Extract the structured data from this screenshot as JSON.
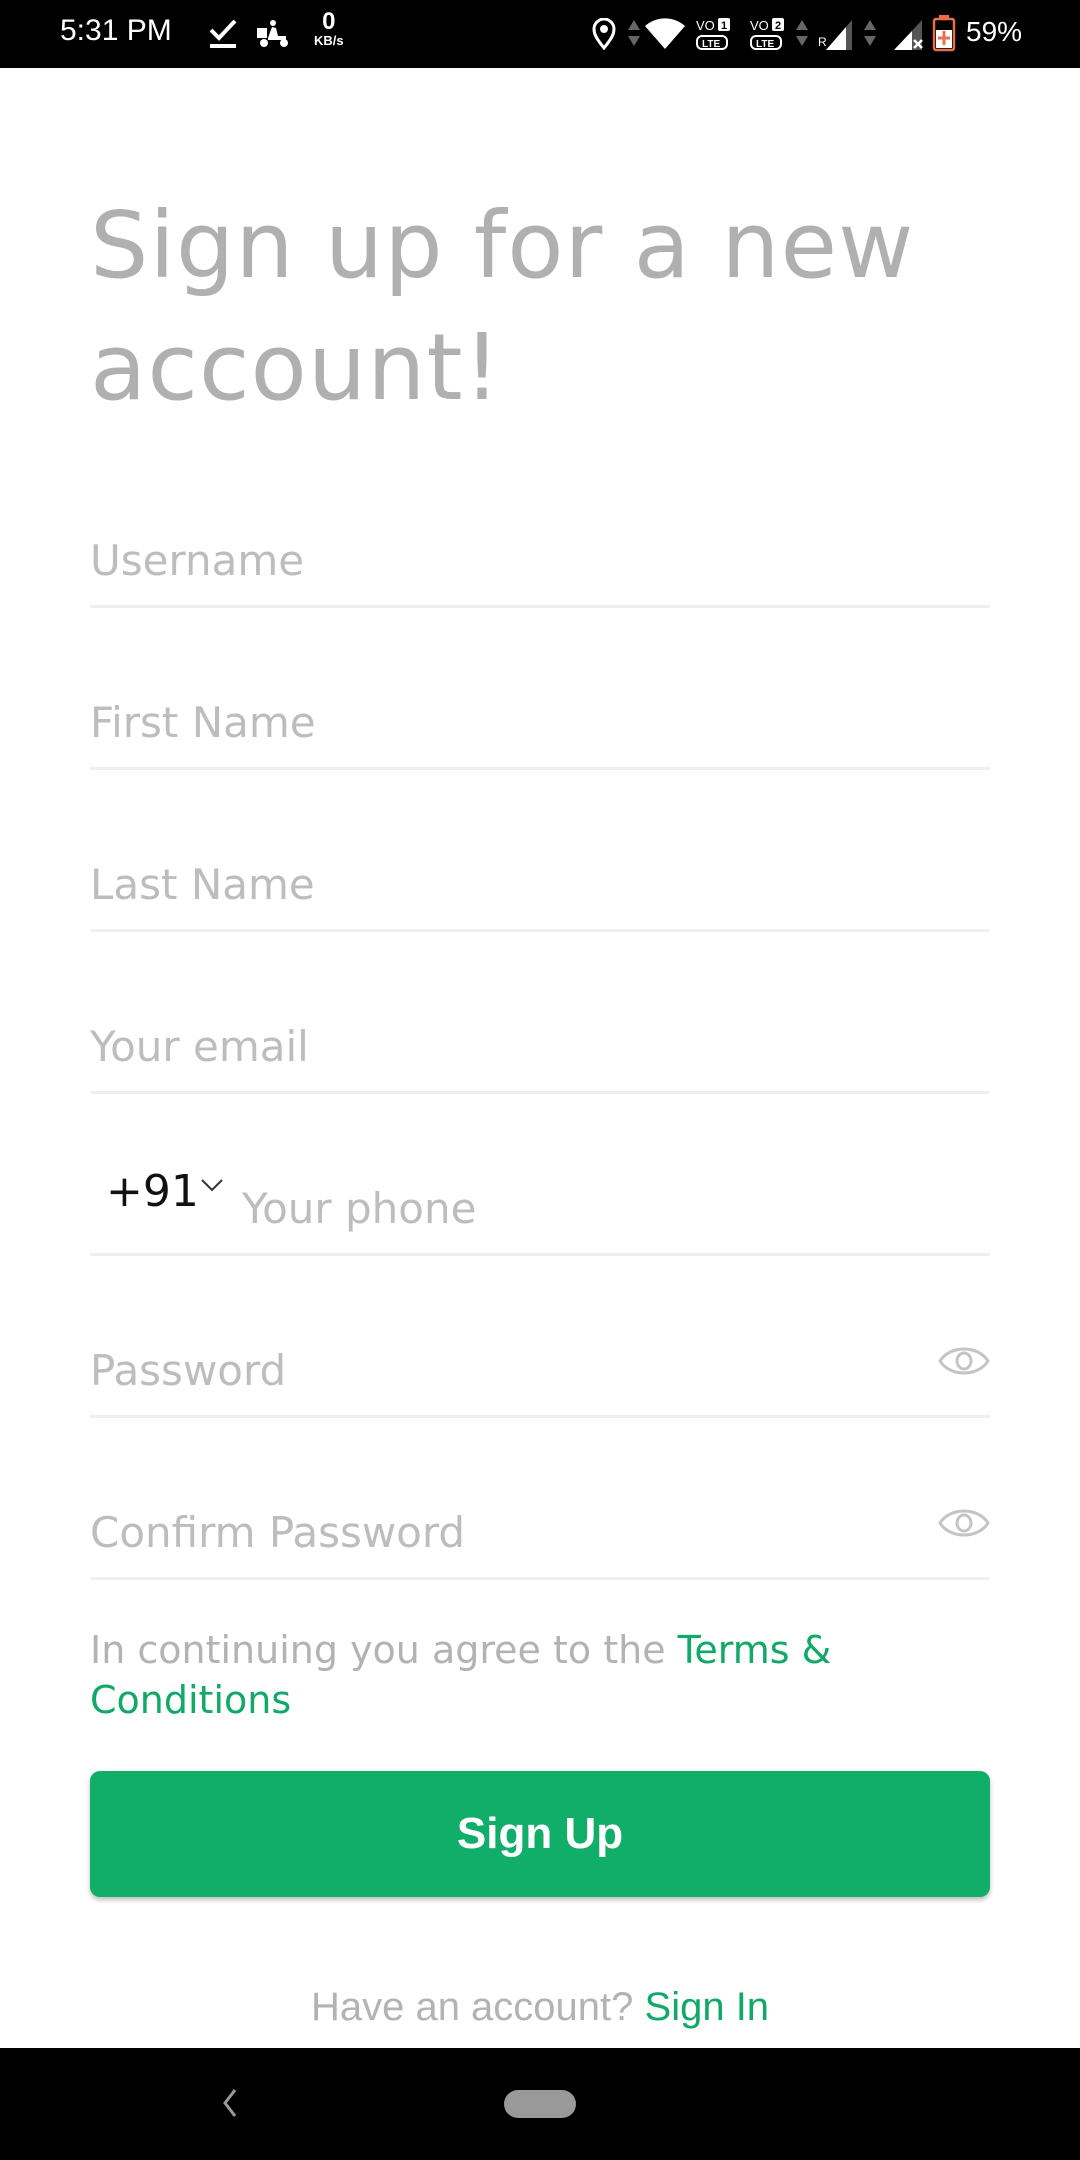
{
  "status_bar": {
    "time": "5:31 PM",
    "net_speed_value": "0",
    "net_speed_unit": "KB/s",
    "sim1_label": "VO",
    "sim1_index": "1",
    "sim2_label": "VO",
    "sim2_index": "2",
    "lte_label": "LTE",
    "roaming_label": "R",
    "battery_percent": "59%",
    "icons": [
      "download-done-icon",
      "delivery-scooter-icon",
      "location-icon",
      "data-arrows-icon",
      "wifi-icon",
      "volte1-icon",
      "volte2-icon",
      "signal-roaming-icon",
      "signal-no-service-icon",
      "battery-charging-icon"
    ]
  },
  "page": {
    "title": "Sign up for a new account!"
  },
  "form": {
    "username_placeholder": "Username",
    "first_name_placeholder": "First Name",
    "last_name_placeholder": "Last Name",
    "email_placeholder": "Your email",
    "country_code": "+91",
    "phone_placeholder": "Your phone",
    "password_placeholder": "Password",
    "confirm_password_placeholder": "Confirm Password"
  },
  "terms": {
    "prefix": "In continuing you agree to the ",
    "link": "Terms & Conditions"
  },
  "signup_button": "Sign Up",
  "footer": {
    "prompt": "Have an account? ",
    "link": "Sign In"
  },
  "colors": {
    "accent": "#10ae68",
    "link": "#10a968",
    "placeholder": "#bdbdbd",
    "title": "#b0b0b0"
  }
}
